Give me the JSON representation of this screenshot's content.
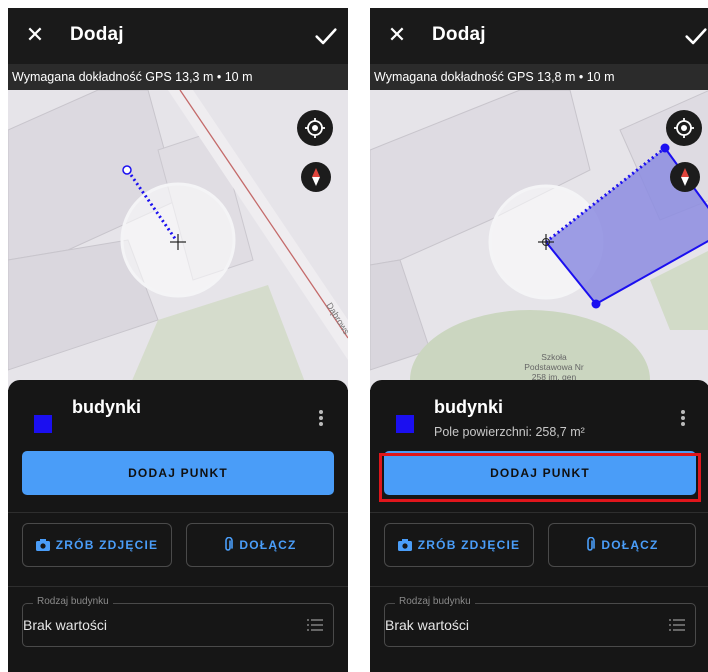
{
  "screens": [
    {
      "topbar": {
        "close_glyph": "✕",
        "title": "Dodaj",
        "confirm_icon": "check-icon"
      },
      "gps_bar": {
        "text": "Wymagana dokładność GPS 13,3 m • 10 m"
      },
      "map": {
        "street_label": "Dąbrows",
        "school_label": ""
      },
      "sheet": {
        "layer_name": "budynki",
        "layer_area": "",
        "layer_color": "#1b0ff0",
        "add_point_label": "DODAJ PUNKT",
        "photo_label": "ZRÓB ZDJĘCIE",
        "attach_label": "DOŁĄCZ",
        "field_label": "Rodzaj budynku",
        "field_value": "Brak wartości"
      }
    },
    {
      "topbar": {
        "close_glyph": "✕",
        "title": "Dodaj",
        "confirm_icon": "check-icon"
      },
      "gps_bar": {
        "text": "Wymagana dokładność GPS 13,8 m • 10 m"
      },
      "map": {
        "street_label": "",
        "school_label": [
          "Szkoła",
          "Podstawowa Nr",
          "258 im. gen"
        ]
      },
      "sheet": {
        "layer_name": "budynki",
        "layer_area": "Pole powierzchni: 258,7 m²",
        "layer_color": "#1b0ff0",
        "add_point_label": "DODAJ PUNKT",
        "photo_label": "ZRÓB ZDJĘCIE",
        "attach_label": "DOŁĄCZ",
        "field_label": "Rodzaj budynku",
        "field_value": "Brak wartości"
      }
    }
  ],
  "colors": {
    "accent": "#4a9df8",
    "highlight": "#e0161c",
    "geometry": "#1b0ff0",
    "polygon_fill": "#8c8ce0"
  }
}
